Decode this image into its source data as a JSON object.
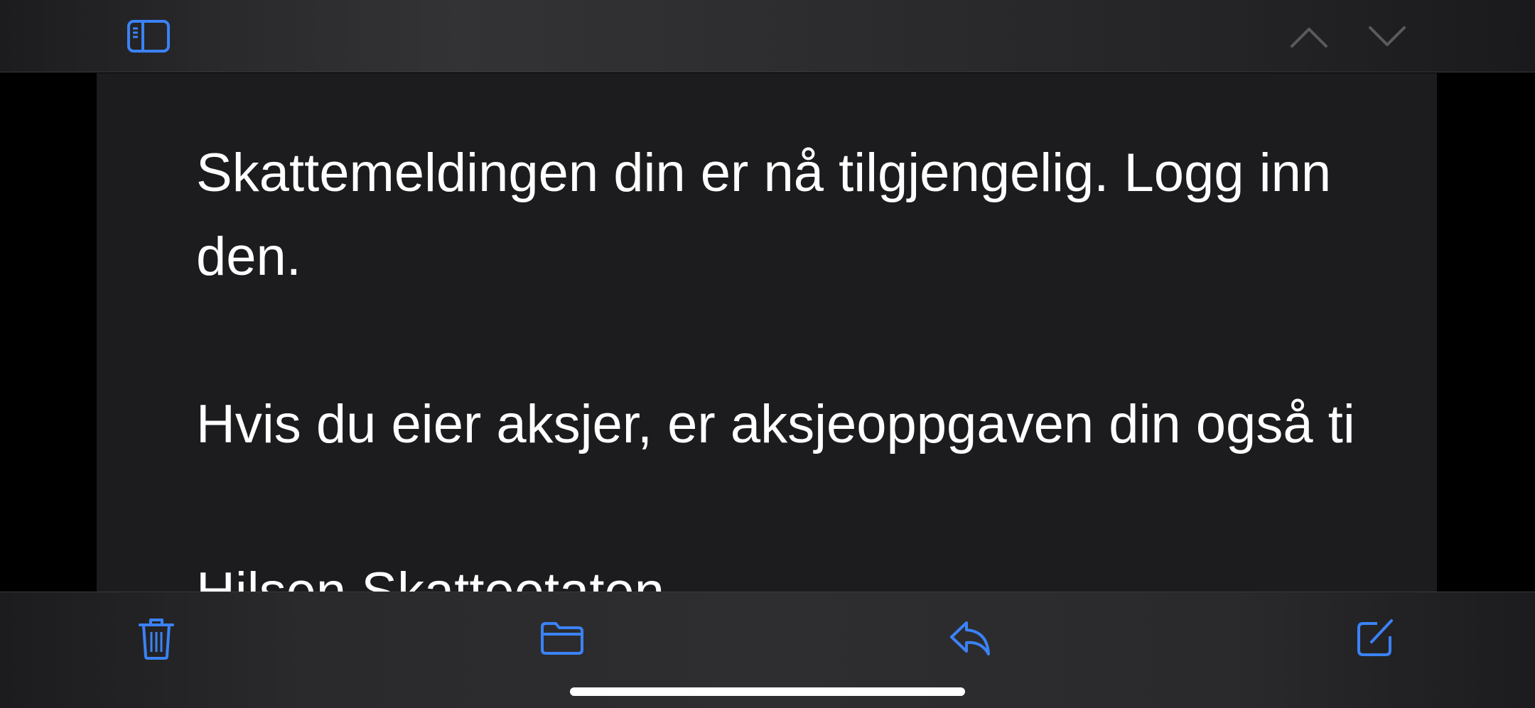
{
  "top_bar": {
    "sidebar_toggle_icon": "sidebar-icon",
    "prev_icon": "chevron-up-icon",
    "next_icon": "chevron-down-icon"
  },
  "message": {
    "paragraphs": [
      {
        "lines": [
          "Skattemeldingen din er nå tilgjengelig. Logg inn",
          "den."
        ]
      },
      {
        "lines": [
          "Hvis du eier aksjer, er aksjeoppgaven din også ti"
        ]
      },
      {
        "lines": [
          "Hilsen Skatteetaten"
        ]
      }
    ]
  },
  "toolbar": {
    "trash_icon": "trash-icon",
    "folder_icon": "folder-icon",
    "reply_icon": "reply-icon",
    "compose_icon": "compose-icon"
  },
  "colors": {
    "accent": "#3b82f6",
    "inactive": "#5a5a5e",
    "background": "#1c1c1e",
    "text": "#ffffff"
  }
}
